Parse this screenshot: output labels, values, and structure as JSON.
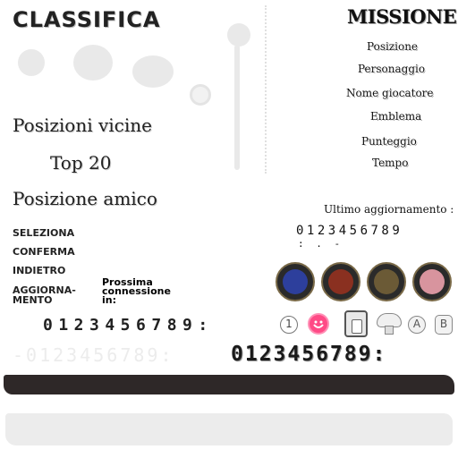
{
  "screen_title": "CLASSIFICA",
  "left_menu": {
    "nearby": "Posizioni vicine",
    "top20": "Top 20",
    "friend": "Posizione amico"
  },
  "controls": {
    "select": "SELEZIONA",
    "confirm": "CONFERMA",
    "back": "INDIETRO",
    "refresh_line1": "AGGIORNA-",
    "refresh_line2": "MENTO"
  },
  "next_connection": {
    "line1": "Prossima",
    "line2": "connessione",
    "line3": "in:"
  },
  "mission": {
    "title": "MISSIONE",
    "columns": [
      "Posizione",
      "Personaggio",
      "Nome giocatore",
      "Emblema",
      "Punteggio",
      "Tempo"
    ]
  },
  "last_update": {
    "label": "Ultimo aggiornamento :",
    "digits": "0123456789",
    "symbols": ": . -"
  },
  "digits_row_mid": "0123456789:",
  "digits_row_ghost": "-0123456789:",
  "digits_row_big": "0123456789:",
  "icons": {
    "number_one": "1",
    "button_a": "A",
    "button_b": "B"
  },
  "colors": {
    "smiley_pink": "#ff4a86",
    "brush_dark": "#2e2828",
    "avatar_ring": "#7a6a48"
  }
}
